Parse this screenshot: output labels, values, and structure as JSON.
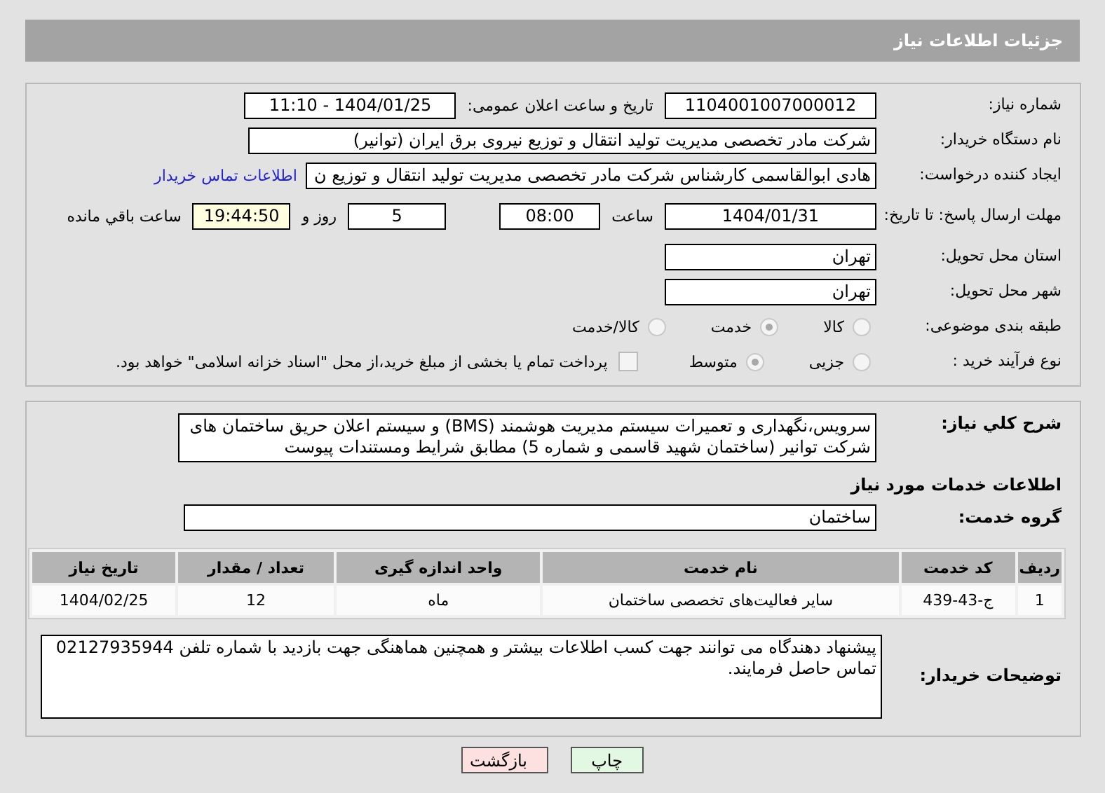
{
  "header": {
    "title": "جزئیات اطلاعات نیاز"
  },
  "need_number": {
    "label": "شماره نیاز:",
    "value": "1104001007000012"
  },
  "announce": {
    "label": "تاریخ و ساعت اعلان عمومی:",
    "value": "1404/01/25 - 11:10"
  },
  "buyer": {
    "label": "نام دستگاه خریدار:",
    "value": "شرکت مادر تخصصی مدیریت تولید  انتقال و توزیع نیروی برق ایران (توانیر)"
  },
  "requester": {
    "label": "ایجاد کننده درخواست:",
    "value": "هادی ابوالقاسمی کارشناس شرکت مادر تخصصی مدیریت تولید  انتقال و توزیع ن",
    "link": "اطلاعات تماس خریدار"
  },
  "deadline": {
    "label": "مهلت ارسال پاسخ: تا تاریخ:",
    "date": "1404/01/31",
    "time_label": "ساعت",
    "time": "08:00",
    "days": "5",
    "days_label": "روز و",
    "remaining": "19:44:50",
    "remaining_label": "ساعت باقي مانده"
  },
  "province": {
    "label": "استان محل تحویل:",
    "value": "تهران"
  },
  "city": {
    "label": "شهر محل تحویل:",
    "value": "تهران"
  },
  "category": {
    "label": "طبقه بندی موضوعی:",
    "options": [
      {
        "label": "کالا",
        "selected": false
      },
      {
        "label": "خدمت",
        "selected": true
      },
      {
        "label": "کالا/خدمت",
        "selected": false
      }
    ]
  },
  "purchase_type": {
    "label": "نوع فرآیند خرید :",
    "options": [
      {
        "label": "جزیی",
        "selected": false
      },
      {
        "label": "متوسط",
        "selected": true
      }
    ],
    "treasury": {
      "label": "پرداخت تمام یا بخشی از مبلغ خرید،از محل \"اسناد خزانه اسلامی\" خواهد بود.",
      "checked": false
    }
  },
  "description": {
    "label": "شرح كلي نياز:",
    "value": "سرویس،نگهداری و تعمیرات سیستم مدیریت هوشمند (BMS) و سیستم اعلان حریق ساختمان های شرکت توانیر (ساختمان شهید قاسمی و شماره 5) مطابق شرایط ومستندات پیوست"
  },
  "services_heading": "اطلاعات خدمات مورد نیاز",
  "service_group": {
    "label": "گروه خدمت:",
    "value": "ساختمان"
  },
  "table": {
    "columns": [
      "ردیف",
      "کد خدمت",
      "نام خدمت",
      "واحد اندازه گیری",
      "تعداد / مقدار",
      "تاریخ نیاز"
    ],
    "rows": [
      [
        "1",
        "ج-43-439",
        "سایر فعالیت‌های تخصصی ساختمان",
        "ماه",
        "12",
        "1404/02/25"
      ]
    ]
  },
  "notes": {
    "label": "توضیحات خریدار:",
    "value": "پیشنهاد دهندگاه می توانند جهت کسب اطلاعات بیشتر و همچنین هماهنگی جهت بازدید با شماره تلفن 02127935944 تماس حاصل فرمایند."
  },
  "buttons": [
    {
      "label": "چاپ",
      "kind": "print"
    },
    {
      "label": "بازگشت",
      "kind": "back"
    }
  ]
}
